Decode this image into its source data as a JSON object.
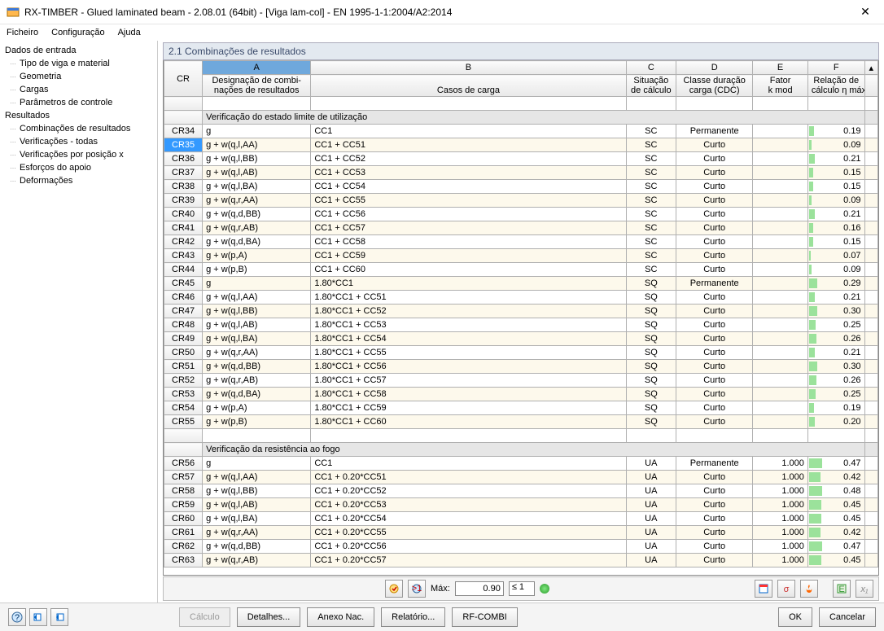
{
  "window": {
    "title": "RX-TIMBER - Glued laminated beam - 2.08.01 (64bit) - [Viga lam-col] - EN 1995-1-1:2004/A2:2014"
  },
  "menu": {
    "file": "Ficheiro",
    "config": "Configuração",
    "help": "Ajuda"
  },
  "tree": {
    "input_root": "Dados de entrada",
    "input": [
      "Tipo de viga e material",
      "Geometria",
      "Cargas",
      "Parâmetros de controle"
    ],
    "results_root": "Resultados",
    "results": [
      "Combinações de resultados",
      "Verificações - todas",
      "Verificações por posição x",
      "Esforços do apoio",
      "Deformações"
    ]
  },
  "panel_title": "2.1 Combinações de resultados",
  "columns": {
    "cr": "CR",
    "A": "A",
    "B": "B",
    "C": "C",
    "D": "D",
    "E": "E",
    "F": "F",
    "a1": "Designação de combi-",
    "a2": "nações de resultados",
    "b2": "Casos de carga",
    "c1": "Situação",
    "c2": "de cálculo",
    "d1": "Classe duração",
    "d2": "carga (CDC)",
    "e1": "Fator",
    "e2": "k mod",
    "f1": "Relação de",
    "f2": "cálculo η máx"
  },
  "sections": {
    "sls": "Verificação do estado limite de utilização",
    "fire": "Verificação da resistência ao fogo"
  },
  "selected_cr": "CR35",
  "rows_sls": [
    {
      "cr": "CR34",
      "a": "g",
      "b": "CC1",
      "c": "SC",
      "d": "Permanente",
      "e": "",
      "f": "0.19"
    },
    {
      "cr": "CR35",
      "a": "g + w(q,l,AA)",
      "b": "CC1 + CC51",
      "c": "SC",
      "d": "Curto",
      "e": "",
      "f": "0.09"
    },
    {
      "cr": "CR36",
      "a": "g + w(q,l,BB)",
      "b": "CC1 + CC52",
      "c": "SC",
      "d": "Curto",
      "e": "",
      "f": "0.21"
    },
    {
      "cr": "CR37",
      "a": "g + w(q,l,AB)",
      "b": "CC1 + CC53",
      "c": "SC",
      "d": "Curto",
      "e": "",
      "f": "0.15"
    },
    {
      "cr": "CR38",
      "a": "g + w(q,l,BA)",
      "b": "CC1 + CC54",
      "c": "SC",
      "d": "Curto",
      "e": "",
      "f": "0.15"
    },
    {
      "cr": "CR39",
      "a": "g + w(q,r,AA)",
      "b": "CC1 + CC55",
      "c": "SC",
      "d": "Curto",
      "e": "",
      "f": "0.09"
    },
    {
      "cr": "CR40",
      "a": "g + w(q,d,BB)",
      "b": "CC1 + CC56",
      "c": "SC",
      "d": "Curto",
      "e": "",
      "f": "0.21"
    },
    {
      "cr": "CR41",
      "a": "g + w(q,r,AB)",
      "b": "CC1 + CC57",
      "c": "SC",
      "d": "Curto",
      "e": "",
      "f": "0.16"
    },
    {
      "cr": "CR42",
      "a": "g + w(q,d,BA)",
      "b": "CC1 + CC58",
      "c": "SC",
      "d": "Curto",
      "e": "",
      "f": "0.15"
    },
    {
      "cr": "CR43",
      "a": "g + w(p,A)",
      "b": "CC1 + CC59",
      "c": "SC",
      "d": "Curto",
      "e": "",
      "f": "0.07"
    },
    {
      "cr": "CR44",
      "a": "g + w(p,B)",
      "b": "CC1 + CC60",
      "c": "SC",
      "d": "Curto",
      "e": "",
      "f": "0.09"
    },
    {
      "cr": "CR45",
      "a": "g",
      "b": "1.80*CC1",
      "c": "SQ",
      "d": "Permanente",
      "e": "",
      "f": "0.29"
    },
    {
      "cr": "CR46",
      "a": "g + w(q,l,AA)",
      "b": "1.80*CC1 + CC51",
      "c": "SQ",
      "d": "Curto",
      "e": "",
      "f": "0.21"
    },
    {
      "cr": "CR47",
      "a": "g + w(q,l,BB)",
      "b": "1.80*CC1 + CC52",
      "c": "SQ",
      "d": "Curto",
      "e": "",
      "f": "0.30"
    },
    {
      "cr": "CR48",
      "a": "g + w(q,l,AB)",
      "b": "1.80*CC1 + CC53",
      "c": "SQ",
      "d": "Curto",
      "e": "",
      "f": "0.25"
    },
    {
      "cr": "CR49",
      "a": "g + w(q,l,BA)",
      "b": "1.80*CC1 + CC54",
      "c": "SQ",
      "d": "Curto",
      "e": "",
      "f": "0.26"
    },
    {
      "cr": "CR50",
      "a": "g + w(q,r,AA)",
      "b": "1.80*CC1 + CC55",
      "c": "SQ",
      "d": "Curto",
      "e": "",
      "f": "0.21"
    },
    {
      "cr": "CR51",
      "a": "g + w(q,d,BB)",
      "b": "1.80*CC1 + CC56",
      "c": "SQ",
      "d": "Curto",
      "e": "",
      "f": "0.30"
    },
    {
      "cr": "CR52",
      "a": "g + w(q,r,AB)",
      "b": "1.80*CC1 + CC57",
      "c": "SQ",
      "d": "Curto",
      "e": "",
      "f": "0.26"
    },
    {
      "cr": "CR53",
      "a": "g + w(q,d,BA)",
      "b": "1.80*CC1 + CC58",
      "c": "SQ",
      "d": "Curto",
      "e": "",
      "f": "0.25"
    },
    {
      "cr": "CR54",
      "a": "g + w(p,A)",
      "b": "1.80*CC1 + CC59",
      "c": "SQ",
      "d": "Curto",
      "e": "",
      "f": "0.19"
    },
    {
      "cr": "CR55",
      "a": "g + w(p,B)",
      "b": "1.80*CC1 + CC60",
      "c": "SQ",
      "d": "Curto",
      "e": "",
      "f": "0.20"
    }
  ],
  "rows_fire": [
    {
      "cr": "CR56",
      "a": "g",
      "b": "CC1",
      "c": "UA",
      "d": "Permanente",
      "e": "1.000",
      "f": "0.47"
    },
    {
      "cr": "CR57",
      "a": "g + w(q,l,AA)",
      "b": "CC1 + 0.20*CC51",
      "c": "UA",
      "d": "Curto",
      "e": "1.000",
      "f": "0.42"
    },
    {
      "cr": "CR58",
      "a": "g + w(q,l,BB)",
      "b": "CC1 + 0.20*CC52",
      "c": "UA",
      "d": "Curto",
      "e": "1.000",
      "f": "0.48"
    },
    {
      "cr": "CR59",
      "a": "g + w(q,l,AB)",
      "b": "CC1 + 0.20*CC53",
      "c": "UA",
      "d": "Curto",
      "e": "1.000",
      "f": "0.45"
    },
    {
      "cr": "CR60",
      "a": "g + w(q,l,BA)",
      "b": "CC1 + 0.20*CC54",
      "c": "UA",
      "d": "Curto",
      "e": "1.000",
      "f": "0.45"
    },
    {
      "cr": "CR61",
      "a": "g + w(q,r,AA)",
      "b": "CC1 + 0.20*CC55",
      "c": "UA",
      "d": "Curto",
      "e": "1.000",
      "f": "0.42"
    },
    {
      "cr": "CR62",
      "a": "g + w(q,d,BB)",
      "b": "CC1 + 0.20*CC56",
      "c": "UA",
      "d": "Curto",
      "e": "1.000",
      "f": "0.47"
    },
    {
      "cr": "CR63",
      "a": "g + w(q,r,AB)",
      "b": "CC1 + 0.20*CC57",
      "c": "UA",
      "d": "Curto",
      "e": "1.000",
      "f": "0.45"
    }
  ],
  "toolbar": {
    "max_label": "Máx:",
    "max_value": "0.90",
    "max_le": "≤ 1"
  },
  "buttons": {
    "calc": "Cálculo",
    "details": "Detalhes...",
    "annex": "Anexo Nac.",
    "report": "Relatório...",
    "rfcombi": "RF-COMBI",
    "ok": "OK",
    "cancel": "Cancelar"
  }
}
